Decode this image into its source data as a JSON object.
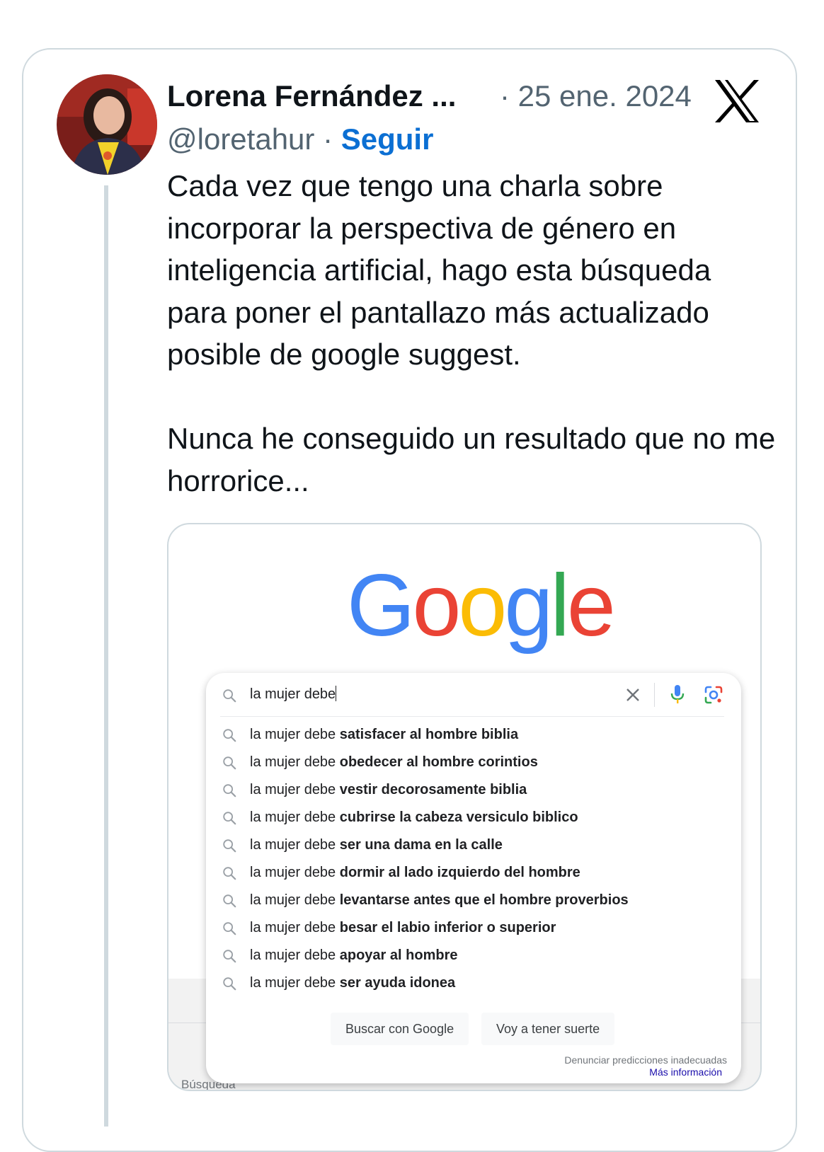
{
  "post": {
    "author_name": "Lorena Fernández ...",
    "date": "· 25 ene. 2024",
    "handle": "@loretahur",
    "separator": "·",
    "follow_label": "Seguir",
    "text_paragraph_1": "Cada vez que tengo una charla sobre incorporar la perspectiva de género en inteligencia artificial, hago esta búsqueda para poner el pantallazo más actualizado posible de google suggest.",
    "text_paragraph_2": "Nunca he conseguido un resultado que no me horrorice...",
    "platform_icon": "x-logo-icon"
  },
  "media": {
    "google_logo": {
      "letters": [
        {
          "char": "G",
          "color": "#4285F4"
        },
        {
          "char": "o",
          "color": "#EA4335"
        },
        {
          "char": "o",
          "color": "#FBBC05"
        },
        {
          "char": "g",
          "color": "#4285F4"
        },
        {
          "char": "l",
          "color": "#34A853"
        },
        {
          "char": "e",
          "color": "#EA4335"
        }
      ]
    },
    "search": {
      "query": "la mujer debe",
      "suggestions": [
        {
          "prefix": "la mujer debe ",
          "completion": "satisfacer al hombre biblia"
        },
        {
          "prefix": "la mujer debe ",
          "completion": "obedecer al hombre corintios"
        },
        {
          "prefix": "la mujer debe ",
          "completion": "vestir decorosamente biblia"
        },
        {
          "prefix": "la mujer debe ",
          "completion": "cubrirse la cabeza versiculo biblico"
        },
        {
          "prefix": "la mujer debe ",
          "completion": "ser una dama en la calle"
        },
        {
          "prefix": "la mujer debe ",
          "completion": "dormir al lado izquierdo del hombre"
        },
        {
          "prefix": "la mujer debe ",
          "completion": "levantarse antes que el hombre proverbios"
        },
        {
          "prefix": "la mujer debe ",
          "completion": "besar el labio inferior o superior"
        },
        {
          "prefix": "la mujer debe ",
          "completion": "apoyar al hombre"
        },
        {
          "prefix": "la mujer debe ",
          "completion": "ser ayuda idonea"
        }
      ],
      "button_search": "Buscar con Google",
      "button_lucky": "Voy a tener suerte",
      "report_label": "Denunciar predicciones inadecuadas",
      "more_info_label": "Más información"
    },
    "footer_label": "Búsqueda"
  },
  "colors": {
    "follow_blue": "#0b6fd3",
    "muted_gray": "#536471",
    "border": "#cfd9de"
  }
}
